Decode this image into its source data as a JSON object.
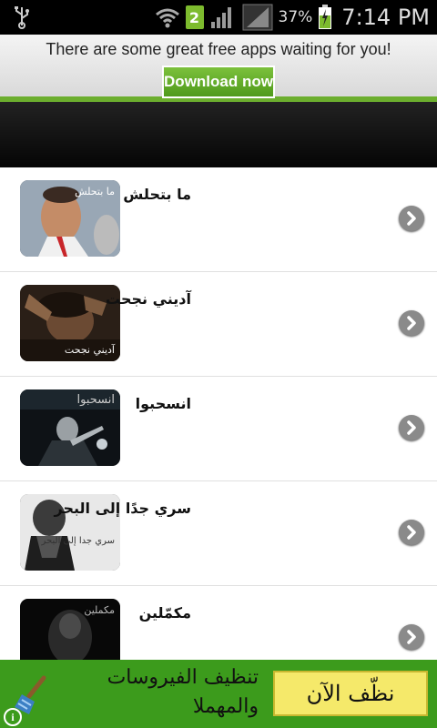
{
  "status_bar": {
    "icons": [
      "usb-icon",
      "wifi-icon",
      "signal-icon",
      "battery-icon"
    ],
    "notification_count": "2",
    "battery_percent": "37%",
    "time": "7:14 PM"
  },
  "ad_top": {
    "text": "There are some great free apps waiting for you!",
    "button_label": "Download now",
    "accent_color": "#6cae2e"
  },
  "list": {
    "items": [
      {
        "title": "ما بتحلش",
        "thumb_caption": "ما بتحلش",
        "icon": "chevron-right-icon"
      },
      {
        "title": "آديني نجحت",
        "thumb_caption": "آديني نجحت",
        "icon": "chevron-right-icon"
      },
      {
        "title": "انسحبوا",
        "thumb_caption": "انسحبوا",
        "icon": "chevron-right-icon"
      },
      {
        "title": "سري جدًا إلى البحر",
        "thumb_caption": "سري جدا إلى البحر",
        "icon": "chevron-right-icon"
      },
      {
        "title": "مكمّلين",
        "thumb_caption": "مكملين",
        "icon": "chevron-right-icon"
      }
    ]
  },
  "ad_bottom": {
    "text": "تنظيف الفيروسات والمهملا",
    "button_label": "نظّف الآن",
    "info_label": "i",
    "background_color": "#3c9b1c"
  }
}
